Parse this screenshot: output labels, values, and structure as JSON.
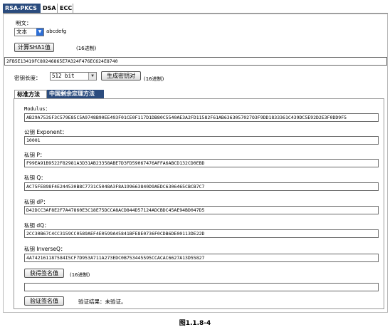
{
  "tabs": [
    "RSA-PKCS",
    "DSA",
    "ECC"
  ],
  "plaintext": {
    "label": "明文：",
    "type_selected": "文本",
    "value": "abcdefg"
  },
  "sha1": {
    "button": "计算SHA1值",
    "hint": "(16进制)",
    "value": "2FB5E13419FC89246865E7A324F476EC624E8740"
  },
  "keylen": {
    "label": "密钥长度：",
    "selected": "512 bit",
    "gen_button": "生成密钥对",
    "hint": "(16进制)"
  },
  "method_tabs": [
    "标准方法",
    "中国剩余定理方法"
  ],
  "fields": {
    "modulus": {
      "label": "Modulus：",
      "value": "AB29A753SF3C579E85C5A9748B90EE493F01CE0F117D1DB80C5540AE3A2FD11582F61AB6363057027O3F9DD1833361C439DC5E92D2E3F0DD9F5"
    },
    "exponent": {
      "label": "公钥 Exponent：",
      "value": "10001"
    },
    "p": {
      "label": "私钥 P：",
      "value": "F99EA91B9522F82981A3D31AB23358ABE7D3FD59067476AFFA6ABCD132CD0EBD"
    },
    "q": {
      "label": "私钥 Q：",
      "value": "AC75FE898F4E244530B8C7731C5048A3F8A199663840D9AEDC6306465CBCB7C7"
    },
    "dp": {
      "label": "私钥 dP：",
      "value": "D42DCC3AF8E2F7A47860E3C18E75DCCA8ACD844D57124ADCBDC45AE94BD047D5"
    },
    "dq": {
      "label": "私钥 dQ：",
      "value": "2CC30B67C4CC3159CC0589AEF4E0599A45841BFE8E0736F0CDB6DE00113DE22D"
    },
    "inverseq": {
      "label": "私钥 InverseQ：",
      "value": "4A742161187584I5CF7D953A711A273EDC0B753445595CCACAC6627A13D55827"
    }
  },
  "sign": {
    "button": "获得签名值",
    "hint": "(16进制)",
    "value": ""
  },
  "verify": {
    "button": "验证签名值",
    "result": "验证结果：未验证。"
  },
  "caption": "图1.1.8-4"
}
